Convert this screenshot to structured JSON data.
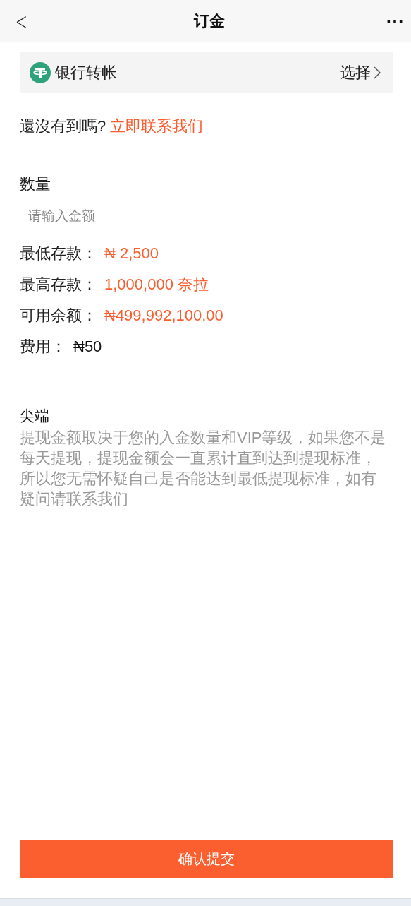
{
  "header": {
    "back": "<",
    "title": "订金",
    "more": "⋯"
  },
  "method": {
    "name": "银行转帐",
    "action": "选择"
  },
  "contact": {
    "prompt": "還沒有到嗎?",
    "link": "立即联系我们"
  },
  "amount": {
    "label": "数量",
    "placeholder": "请输入金额"
  },
  "info": [
    {
      "label": "最低存款：",
      "value": "₦ 2,500",
      "highlight": true
    },
    {
      "label": "最高存款：",
      "value": "1,000,000 奈拉",
      "highlight": true
    },
    {
      "label": "可用余额：",
      "value": "₦499,992,100.00",
      "highlight": true
    },
    {
      "label": "费用：",
      "value": "₦50",
      "highlight": false
    }
  ],
  "tip": {
    "title": "尖端",
    "body": "提现金额取决于您的入金数量和VIP等级，如果您不是每天提现，提现金额会一直累计直到达到提现标准，所以您无需怀疑自己是否能达到最低提现标准，如有疑问请联系我们"
  },
  "submit": "确认提交"
}
